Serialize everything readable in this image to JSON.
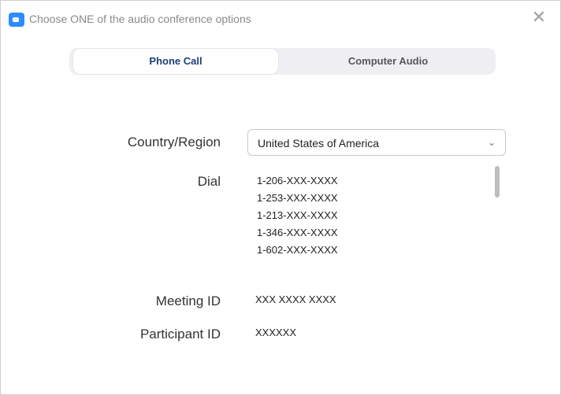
{
  "window": {
    "title": "Choose ONE of the audio conference options"
  },
  "tabs": [
    {
      "label": "Phone Call"
    },
    {
      "label": "Computer Audio"
    }
  ],
  "form": {
    "country_label": "Country/Region",
    "country_value": "United States of America",
    "dial_label": "Dial",
    "dial_numbers": [
      "1-206-XXX-XXXX",
      "1-253-XXX-XXXX",
      "1-213-XXX-XXXX",
      "1-346-XXX-XXXX",
      "1-602-XXX-XXXX"
    ],
    "meeting_label": "Meeting ID",
    "meeting_value": "XXX XXXX XXXX",
    "participant_label": "Participant ID",
    "participant_value": "XXXXXX"
  },
  "icons": {
    "app": "zoom-camera-icon",
    "close": "close-icon",
    "dropdown": "chevron-down-icon"
  }
}
